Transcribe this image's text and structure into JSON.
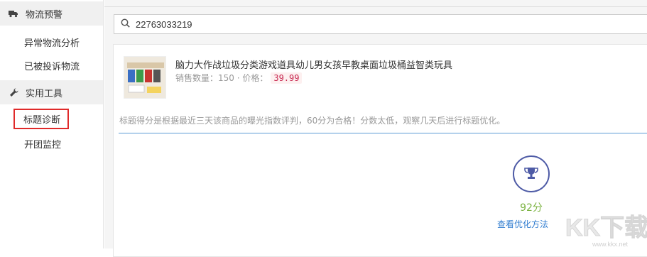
{
  "sidebar": {
    "section_logistics": {
      "label": "物流预警",
      "icon": "truck-icon"
    },
    "logistics_items": [
      "异常物流分析",
      "已被投诉物流"
    ],
    "section_tools": {
      "label": "实用工具",
      "icon": "wrench-icon"
    },
    "tools_items": [
      "标题诊断",
      "开团监控"
    ]
  },
  "search": {
    "value": "22763033219",
    "icon": "search-icon"
  },
  "product": {
    "title": "脑力大作战垃圾分类游戏道具幼儿男女孩早教桌面垃圾桶益智类玩具",
    "sales_label": "销售数量：150 · 价格：",
    "price": "39.99"
  },
  "notice": "标题得分是根据最近三天该商品的曝光指数评判，60分为合格！分数太低，观察几天后进行标题优化。",
  "result": {
    "score": "92分",
    "link_label": "查看优化方法",
    "icon": "trophy-icon"
  },
  "watermark": {
    "brand": "KK下载",
    "url": "www.kkx.net"
  },
  "colors": {
    "active_border": "#e02a2a",
    "score_green": "#7cb342",
    "link_blue": "#2e7bcf",
    "trophy": "#4e5ba6",
    "divider": "#5b9bd5"
  }
}
